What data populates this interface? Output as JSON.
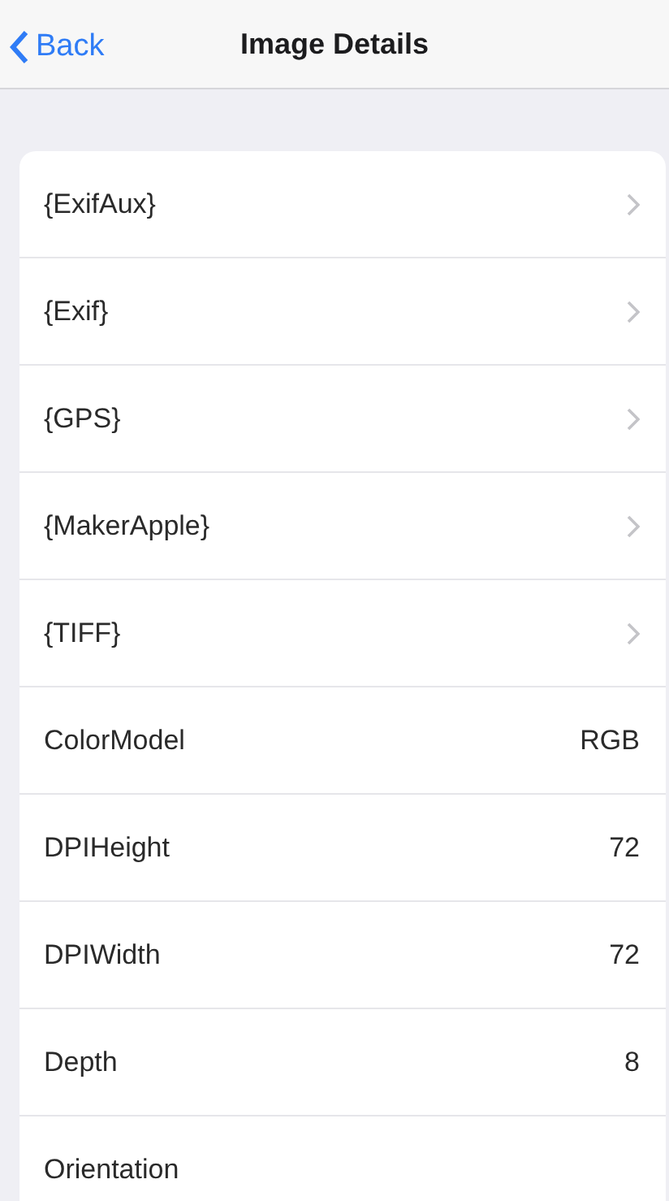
{
  "nav_bar": {
    "back_label": "Back",
    "title": "Image Details"
  },
  "rows": [
    {
      "kind": "link",
      "label": "{ExifAux}"
    },
    {
      "kind": "link",
      "label": "{Exif}"
    },
    {
      "kind": "link",
      "label": "{GPS}"
    },
    {
      "kind": "link",
      "label": "{MakerApple}"
    },
    {
      "kind": "link",
      "label": "{TIFF}"
    },
    {
      "kind": "value",
      "label": "ColorModel",
      "value": "RGB"
    },
    {
      "kind": "value",
      "label": "DPIHeight",
      "value": "72"
    },
    {
      "kind": "value",
      "label": "DPIWidth",
      "value": "72"
    },
    {
      "kind": "value",
      "label": "Depth",
      "value": "8"
    },
    {
      "kind": "plain",
      "label": "Orientation"
    }
  ]
}
